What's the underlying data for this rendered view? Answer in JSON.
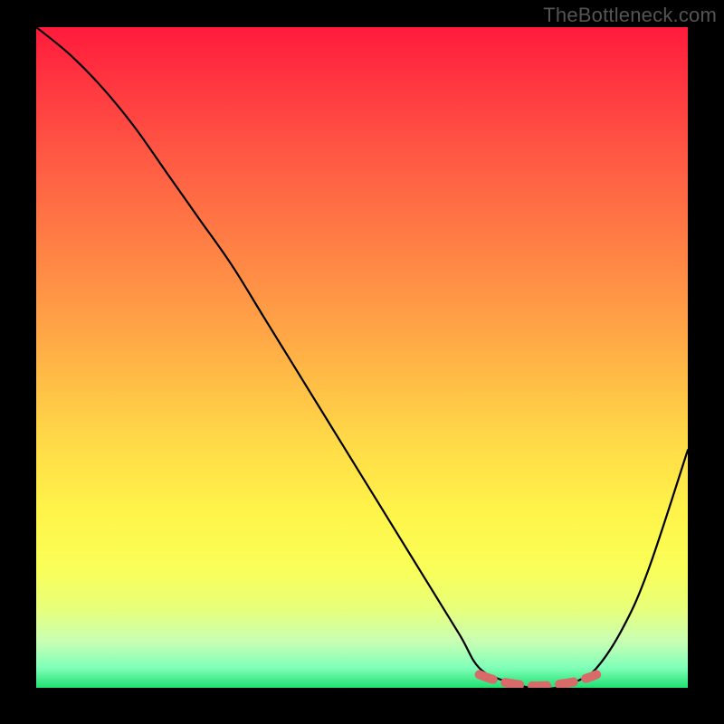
{
  "watermark": "TheBottleneck.com",
  "chart_data": {
    "type": "line",
    "title": "",
    "xlabel": "",
    "ylabel": "",
    "xlim": [
      0,
      100
    ],
    "ylim": [
      0,
      100
    ],
    "series": [
      {
        "name": "bottleneck-curve",
        "color": "#000000",
        "x": [
          0,
          5,
          10,
          15,
          20,
          25,
          30,
          35,
          40,
          45,
          50,
          55,
          60,
          65,
          68,
          72,
          76,
          80,
          83,
          86,
          90,
          94,
          100
        ],
        "values": [
          100,
          96,
          91,
          85,
          78,
          71,
          64,
          56,
          48,
          40,
          32,
          24,
          16,
          8,
          3,
          1,
          0,
          0,
          1,
          3,
          9,
          18,
          36
        ]
      },
      {
        "name": "optimal-range-marker",
        "color": "#d96a6a",
        "x": [
          68,
          70,
          72,
          74,
          76,
          78,
          80,
          82,
          84,
          86
        ],
        "values": [
          2,
          1.3,
          0.8,
          0.5,
          0.3,
          0.3,
          0.5,
          0.8,
          1.3,
          2
        ]
      }
    ],
    "grid": false,
    "legend": false
  }
}
